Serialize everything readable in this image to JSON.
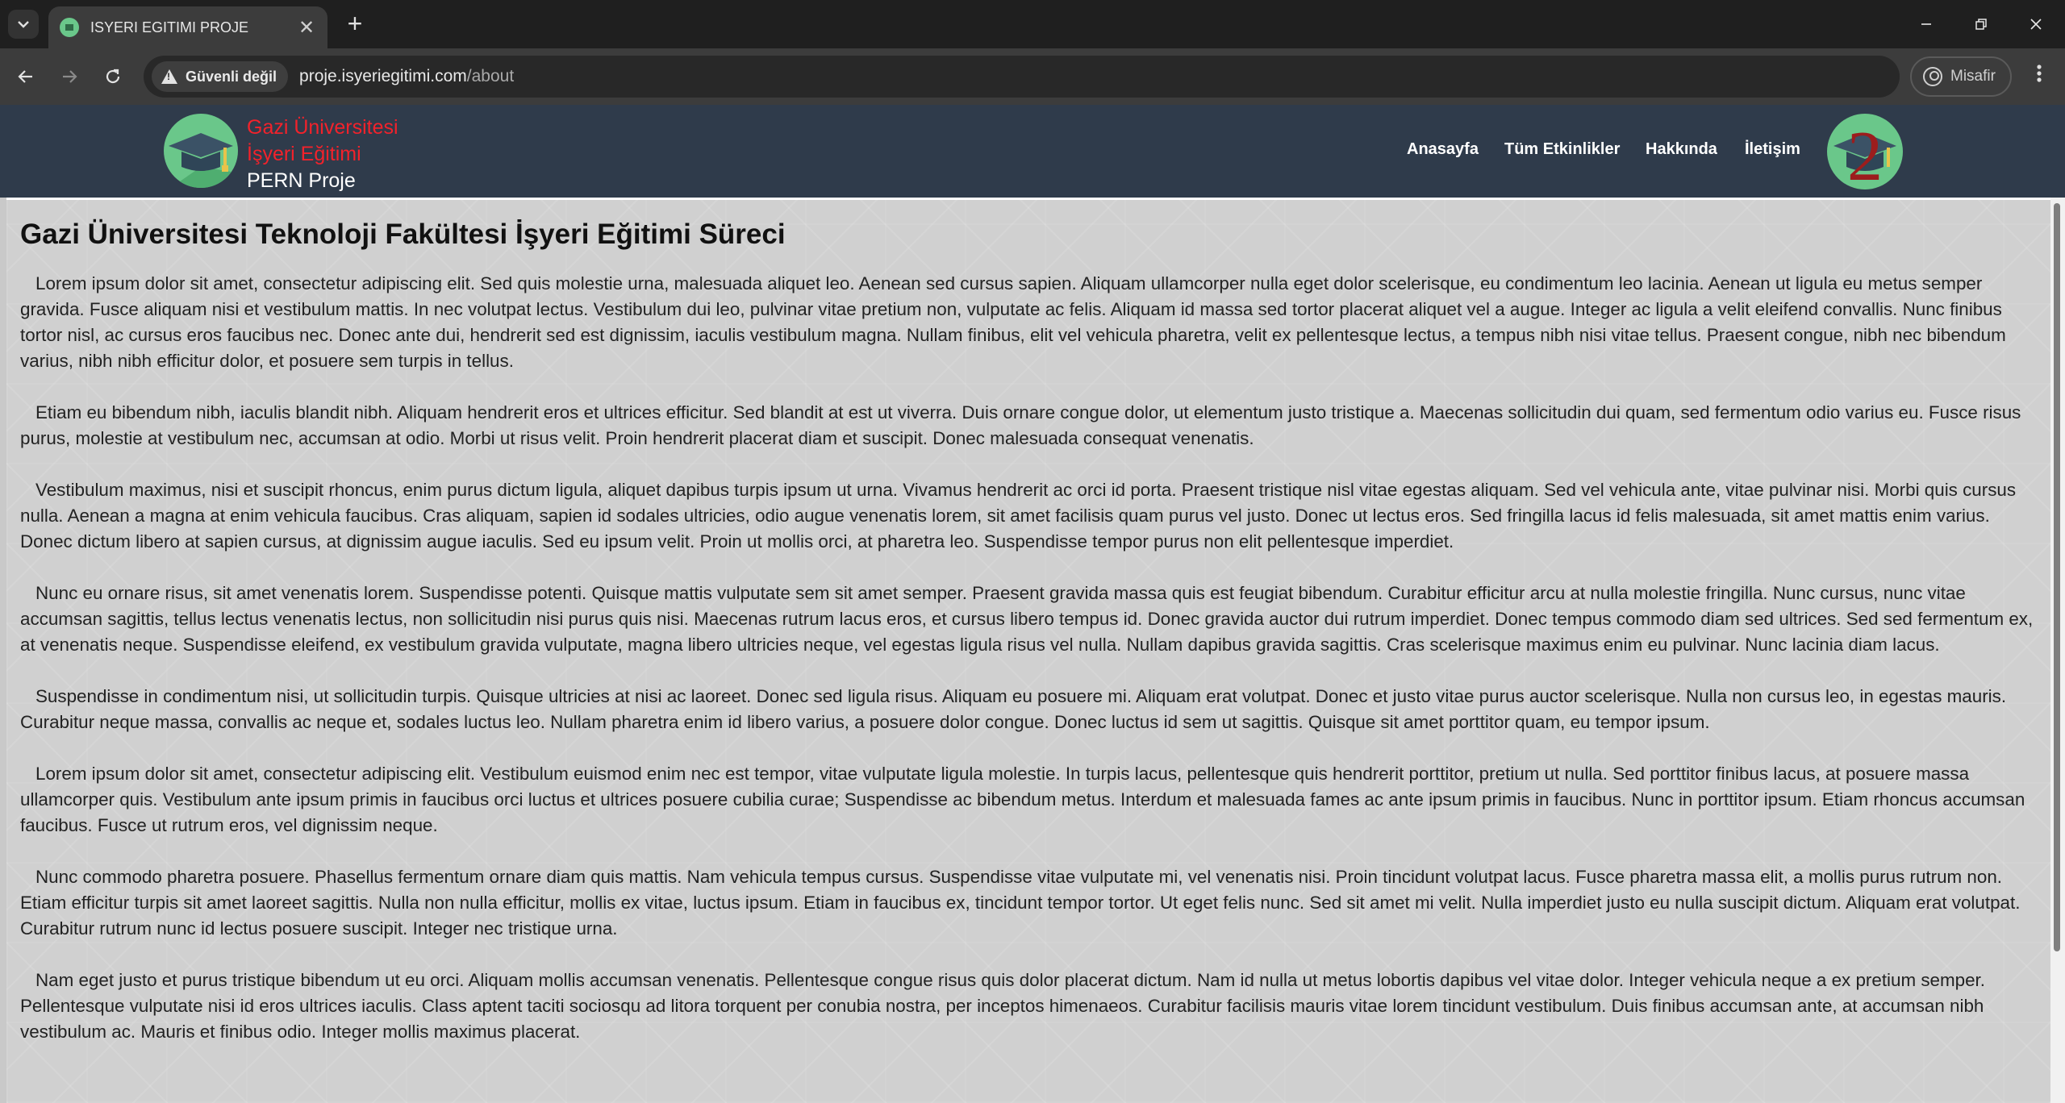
{
  "browser": {
    "tab_title": "ISYERI EGITIMI PROJE",
    "tab_close": "✕",
    "new_tab": "+",
    "security_label": "Güvenli değil",
    "url_host": "proje.isyeriegitimi.com",
    "url_path": "/about",
    "profile_label": "Misafir"
  },
  "site": {
    "brand_line1": "Gazi Üniversitesi",
    "brand_line2": "İşyeri Eğitimi",
    "brand_line3": "PERN Proje",
    "badge_number": "2",
    "nav": {
      "home": "Anasayfa",
      "events": "Tüm Etkinlikler",
      "about": "Hakkında",
      "contact": "İletişim"
    },
    "colors": {
      "header_bg": "#2f3b4b",
      "brand_red": "#f2222b",
      "logo_green": "#6ac78a"
    }
  },
  "content": {
    "title": "Gazi Üniversitesi Teknoloji Fakültesi İşyeri Eğitimi Süreci",
    "paragraphs": [
      "Lorem ipsum dolor sit amet, consectetur adipiscing elit. Sed quis molestie urna, malesuada aliquet leo. Aenean sed cursus sapien. Aliquam ullamcorper nulla eget dolor scelerisque, eu condimentum leo lacinia. Aenean ut ligula eu metus semper gravida. Fusce aliquam nisi et vestibulum mattis. In nec volutpat lectus. Vestibulum dui leo, pulvinar vitae pretium non, vulputate ac felis. Aliquam id massa sed tortor placerat aliquet vel a augue. Integer ac ligula a velit eleifend convallis. Nunc finibus tortor nisl, ac cursus eros faucibus nec. Donec ante dui, hendrerit sed est dignissim, iaculis vestibulum magna. Nullam finibus, elit vel vehicula pharetra, velit ex pellentesque lectus, a tempus nibh nisi vitae tellus. Praesent congue, nibh nec bibendum varius, nibh nibh efficitur dolor, et posuere sem turpis in tellus.",
      "Etiam eu bibendum nibh, iaculis blandit nibh. Aliquam hendrerit eros et ultrices efficitur. Sed blandit at est ut viverra. Duis ornare congue dolor, ut elementum justo tristique a. Maecenas sollicitudin dui quam, sed fermentum odio varius eu. Fusce risus purus, molestie at vestibulum nec, accumsan at odio. Morbi ut risus velit. Proin hendrerit placerat diam et suscipit. Donec malesuada consequat venenatis.",
      "Vestibulum maximus, nisi et suscipit rhoncus, enim purus dictum ligula, aliquet dapibus turpis ipsum ut urna. Vivamus hendrerit ac orci id porta. Praesent tristique nisl vitae egestas aliquam. Sed vel vehicula ante, vitae pulvinar nisi. Morbi quis cursus nulla. Aenean a magna at enim vehicula faucibus. Cras aliquam, sapien id sodales ultricies, odio augue venenatis lorem, sit amet facilisis quam purus vel justo. Donec ut lectus eros. Sed fringilla lacus id felis malesuada, sit amet mattis enim varius. Donec dictum libero at sapien cursus, at dignissim augue iaculis. Sed eu ipsum velit. Proin ut mollis orci, at pharetra leo. Suspendisse tempor purus non elit pellentesque imperdiet.",
      "Nunc eu ornare risus, sit amet venenatis lorem. Suspendisse potenti. Quisque mattis vulputate sem sit amet semper. Praesent gravida massa quis est feugiat bibendum. Curabitur efficitur arcu at nulla molestie fringilla. Nunc cursus, nunc vitae accumsan sagittis, tellus lectus venenatis lectus, non sollicitudin nisi purus quis nisi. Maecenas rutrum lacus eros, et cursus libero tempus id. Donec gravida auctor dui rutrum imperdiet. Donec tempus commodo diam sed ultrices. Sed sed fermentum ex, at venenatis neque. Suspendisse eleifend, ex vestibulum gravida vulputate, magna libero ultricies neque, vel egestas ligula risus vel nulla. Nullam dapibus gravida sagittis. Cras scelerisque maximus enim eu pulvinar. Nunc lacinia diam lacus.",
      "Suspendisse in condimentum nisi, ut sollicitudin turpis. Quisque ultricies at nisi ac laoreet. Donec sed ligula risus. Aliquam eu posuere mi. Aliquam erat volutpat. Donec et justo vitae purus auctor scelerisque. Nulla non cursus leo, in egestas mauris. Curabitur neque massa, convallis ac neque et, sodales luctus leo. Nullam pharetra enim id libero varius, a posuere dolor congue. Donec luctus id sem ut sagittis. Quisque sit amet porttitor quam, eu tempor ipsum.",
      "Lorem ipsum dolor sit amet, consectetur adipiscing elit. Vestibulum euismod enim nec est tempor, vitae vulputate ligula molestie. In turpis lacus, pellentesque quis hendrerit porttitor, pretium ut nulla. Sed porttitor finibus lacus, at posuere massa ullamcorper quis. Vestibulum ante ipsum primis in faucibus orci luctus et ultrices posuere cubilia curae; Suspendisse ac bibendum metus. Interdum et malesuada fames ac ante ipsum primis in faucibus. Nunc in porttitor ipsum. Etiam rhoncus accumsan faucibus. Fusce ut rutrum eros, vel dignissim neque.",
      "Nunc commodo pharetra posuere. Phasellus fermentum ornare diam quis mattis. Nam vehicula tempus cursus. Suspendisse vitae vulputate mi, vel venenatis nisi. Proin tincidunt volutpat lacus. Fusce pharetra massa elit, a mollis purus rutrum non. Etiam efficitur turpis sit amet laoreet sagittis. Nulla non nulla efficitur, mollis ex vitae, luctus ipsum. Etiam in faucibus ex, tincidunt tempor tortor. Ut eget felis nunc. Sed sit amet mi velit. Nulla imperdiet justo eu nulla suscipit dictum. Aliquam erat volutpat. Curabitur rutrum nunc id lectus posuere suscipit. Integer nec tristique urna.",
      "Nam eget justo et purus tristique bibendum ut eu orci. Aliquam mollis accumsan venenatis. Pellentesque congue risus quis dolor placerat dictum. Nam id nulla ut metus lobortis dapibus vel vitae dolor. Integer vehicula neque a ex pretium semper. Pellentesque vulputate nisi id eros ultrices iaculis. Class aptent taciti sociosqu ad litora torquent per conubia nostra, per inceptos himenaeos. Curabitur facilisis mauris vitae lorem tincidunt vestibulum. Duis finibus accumsan ante, at accumsan nibh vestibulum ac. Mauris et finibus odio. Integer mollis maximus placerat."
    ]
  }
}
